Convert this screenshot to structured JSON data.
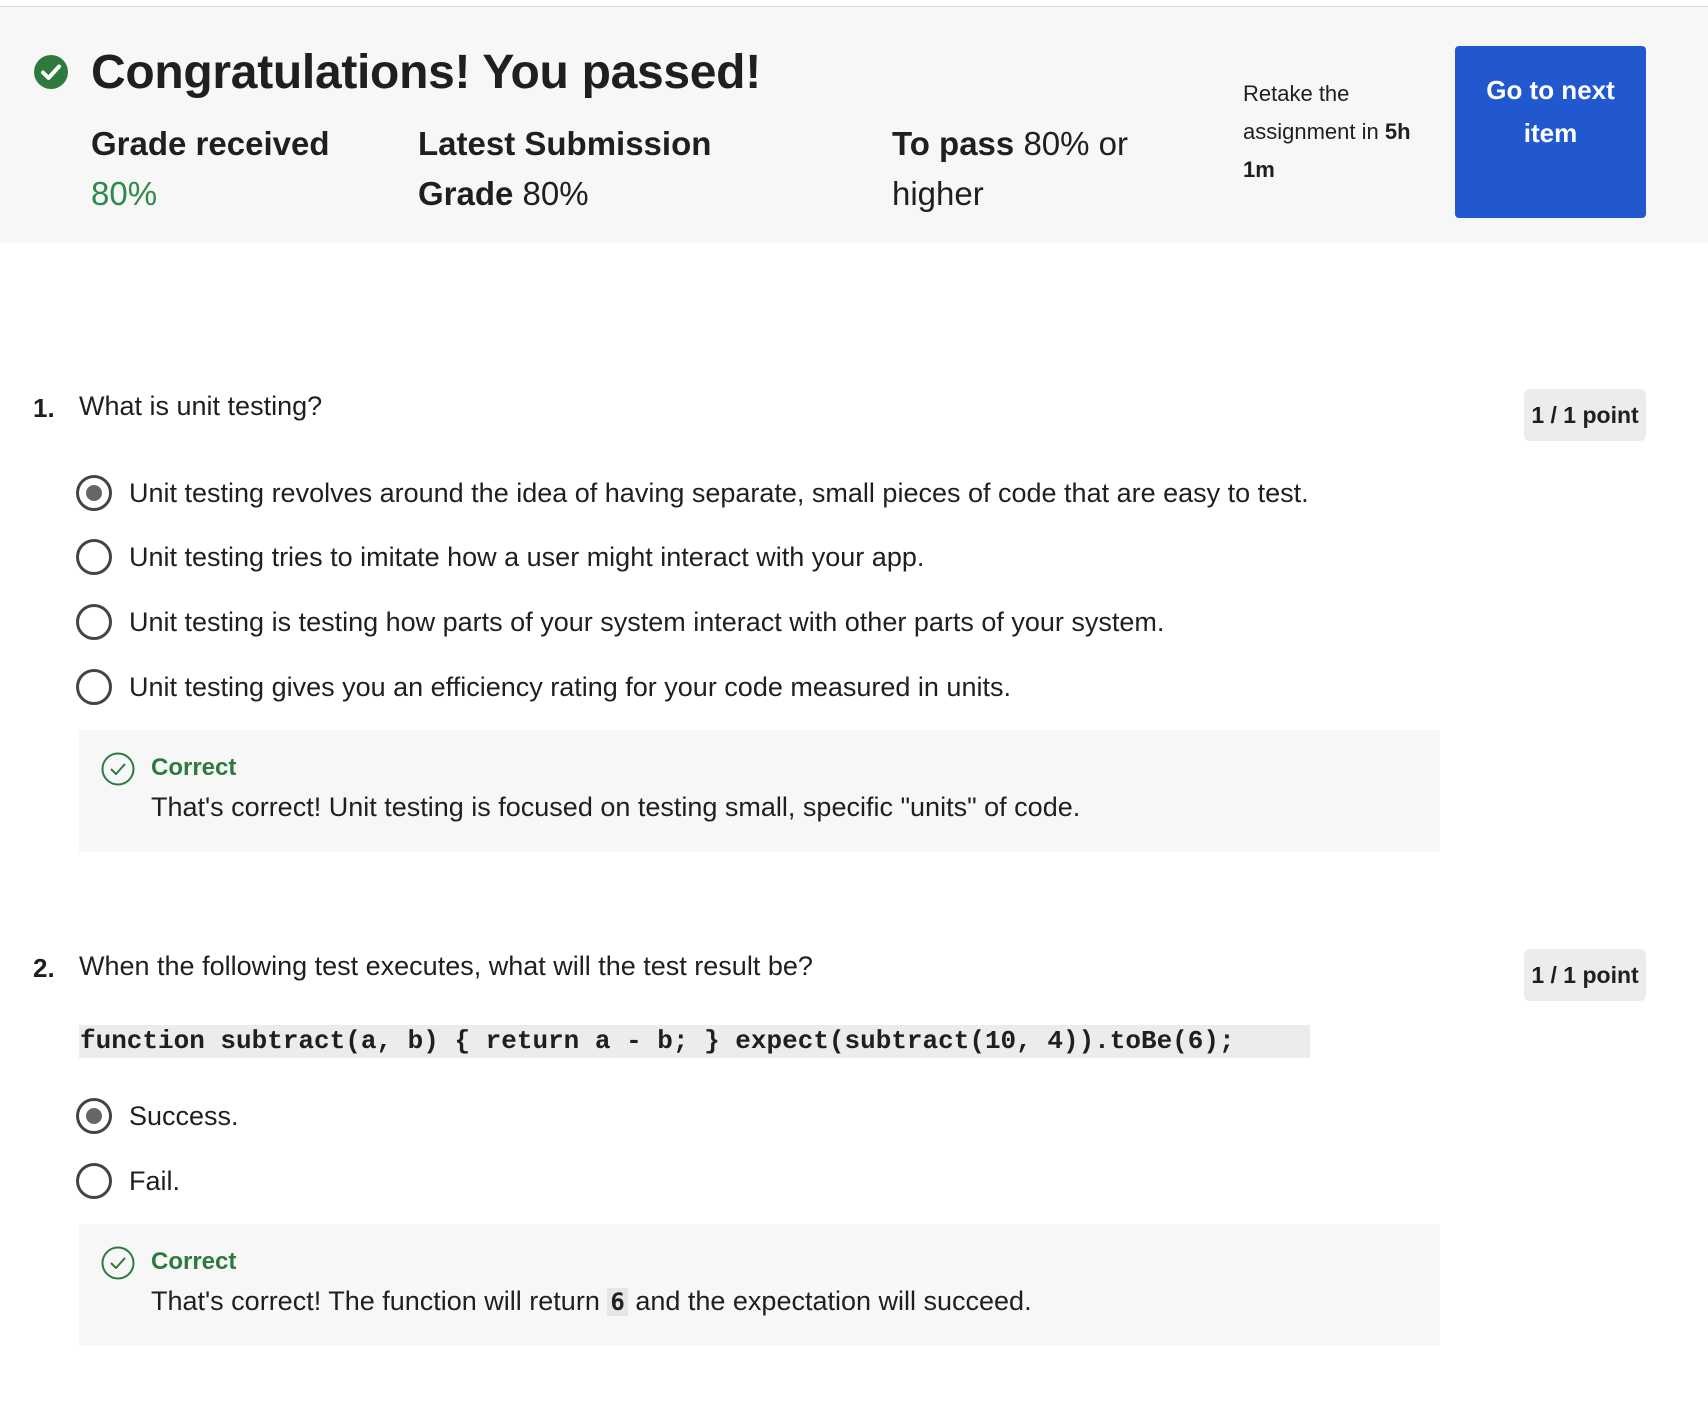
{
  "banner": {
    "title": "Congratulations! You passed!",
    "grade_received": {
      "label": "Grade received",
      "value": "80%"
    },
    "latest_submission": {
      "label": "Latest Submission Grade",
      "value": "80%"
    },
    "to_pass": {
      "label": "To pass",
      "value": "80% or higher"
    },
    "retake": {
      "prefix": "Retake the assignment in",
      "time": "5h 1m"
    },
    "next_button": "Go to next item",
    "success_color": "#2d8a4c",
    "button_color": "#2258cf"
  },
  "questions": [
    {
      "number": "1.",
      "text": "What is unit testing?",
      "points": "1 / 1 point",
      "options": [
        {
          "label": "Unit testing revolves around the idea of having separate, small pieces of code that are easy to test.",
          "selected": true
        },
        {
          "label": "Unit testing tries to imitate how a user might interact with your app.",
          "selected": false
        },
        {
          "label": "Unit testing is testing how parts of your system interact with other parts of your system.",
          "selected": false
        },
        {
          "label": "Unit testing gives you an efficiency rating for your code measured in units.",
          "selected": false
        }
      ],
      "feedback": {
        "title": "Correct",
        "text": "That's correct! Unit testing is focused on testing small, specific \"units\" of code."
      }
    },
    {
      "number": "2.",
      "text": "When the following test executes, what will the test result be?",
      "points": "1 / 1 point",
      "code": "function subtract(a, b) { return a - b; } expect(subtract(10, 4)).toBe(6);",
      "options": [
        {
          "label": "Success.",
          "selected": true
        },
        {
          "label": "Fail.",
          "selected": false
        }
      ],
      "feedback": {
        "title": "Correct",
        "text_before": "That's correct! The function will return",
        "code": "6",
        "text_after": "and the expectation will succeed."
      }
    }
  ]
}
